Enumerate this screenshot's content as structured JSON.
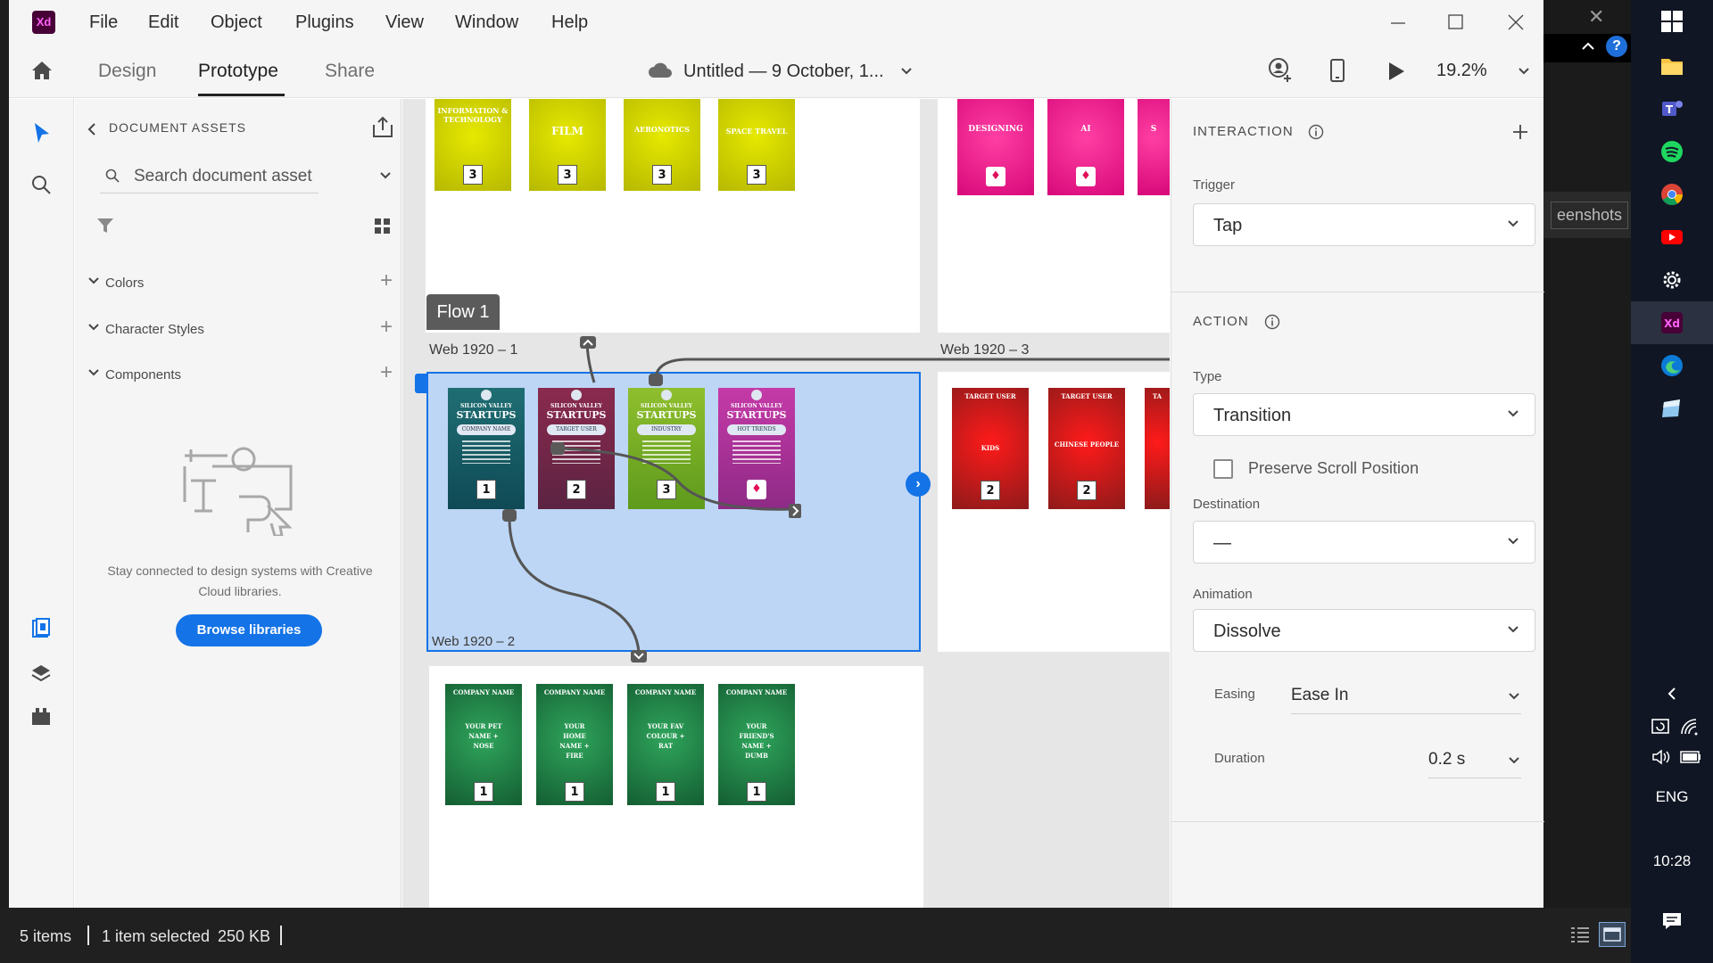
{
  "menu": {
    "app_icon": "Xd",
    "items": [
      "File",
      "Edit",
      "Object",
      "Plugins",
      "View",
      "Window",
      "Help"
    ]
  },
  "toolbar": {
    "tabs": [
      "Design",
      "Prototype",
      "Share"
    ],
    "active_tab": "Prototype",
    "doc_title": "Untitled — 9 October, 1...",
    "zoom": "19.2%"
  },
  "assets": {
    "title": "DOCUMENT ASSETS",
    "search_placeholder": "Search document asset",
    "sections": [
      "Colors",
      "Character Styles",
      "Components"
    ],
    "empty_message": "Stay connected to design systems with Creative Cloud libraries.",
    "browse_label": "Browse libraries"
  },
  "canvas": {
    "flow_label": "Flow 1",
    "boards": {
      "web1": "Web 1920 – 1",
      "web2": "Web 1920 – 2",
      "web3": "Web 1920 – 3"
    },
    "top_cards": [
      {
        "title": "INFORMATION & TECHNOLOGY",
        "num": "3"
      },
      {
        "title": "FILM",
        "num": "3"
      },
      {
        "title": "AERONOTICS",
        "num": "3"
      },
      {
        "title": "SPACE TRAVEL",
        "num": "3"
      }
    ],
    "top_right_cards": [
      {
        "title": "DESIGNING"
      },
      {
        "title": "AI"
      },
      {
        "title": "S"
      }
    ],
    "mid_cards": [
      {
        "top": "SILICON VALLEY",
        "big": "STARTUPS",
        "pill": "COMPANY NAME",
        "num": "1"
      },
      {
        "top": "SILICON VALLEY",
        "big": "STARTUPS",
        "pill": "TARGET USER",
        "num": "2"
      },
      {
        "top": "SILICON VALLEY",
        "big": "STARTUPS",
        "pill": "INDUSTRY",
        "num": "3"
      },
      {
        "top": "SILICON VALLEY",
        "big": "STARTUPS",
        "pill": "HOT TRENDS",
        "num": ""
      }
    ],
    "red_cards": [
      {
        "head": "TARGET USER",
        "body": "KIDS",
        "num": "2"
      },
      {
        "head": "TARGET USER",
        "body": "CHINESE PEOPLE",
        "num": "2"
      },
      {
        "head": "TA",
        "body": "",
        "num": ""
      }
    ],
    "bottom_cards": [
      {
        "head": "COMPANY NAME",
        "body": "YOUR PET NAME + NOSE",
        "num": "1"
      },
      {
        "head": "COMPANY NAME",
        "body": "YOUR HOME NAME + FIRE",
        "num": "1"
      },
      {
        "head": "COMPANY NAME",
        "body": "YOUR FAV COLOUR + RAT",
        "num": "1"
      },
      {
        "head": "COMPANY NAME",
        "body": "YOUR FRIEND'S NAME + DUMB",
        "num": "1"
      }
    ]
  },
  "props": {
    "interaction_title": "INTERACTION",
    "trigger_label": "Trigger",
    "trigger_value": "Tap",
    "action_title": "ACTION",
    "type_label": "Type",
    "type_value": "Transition",
    "preserve_label": "Preserve Scroll Position",
    "destination_label": "Destination",
    "destination_value": "—",
    "animation_label": "Animation",
    "animation_value": "Dissolve",
    "easing_label": "Easing",
    "easing_value": "Ease In",
    "duration_label": "Duration",
    "duration_value": "0.2 s"
  },
  "status": {
    "items": "5 items",
    "selected": "1 item selected",
    "size": "250 KB"
  },
  "background": {
    "panel_text": "eenshots"
  },
  "taskbar": {
    "lang": "ENG",
    "time": "10:28"
  },
  "colors": {
    "accent": "#1473e6",
    "selection": "#bdd6f5",
    "xd_brand": "#470137",
    "xd_pink": "#ff61f6"
  }
}
